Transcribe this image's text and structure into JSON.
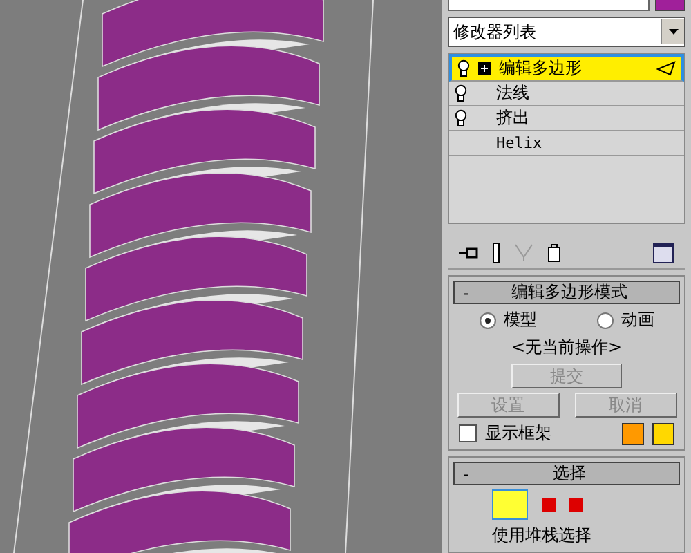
{
  "modifier_list": {
    "label": "修改器列表"
  },
  "stack": [
    {
      "label": "编辑多边形",
      "selected": true,
      "kind": "modifier",
      "expandable": true
    },
    {
      "label": "法线",
      "selected": false,
      "kind": "modifier",
      "expandable": false
    },
    {
      "label": "挤出",
      "selected": false,
      "kind": "modifier",
      "expandable": false
    },
    {
      "label": "Helix",
      "selected": false,
      "kind": "base",
      "expandable": false
    }
  ],
  "mode_rollout": {
    "title": "编辑多边形模式",
    "collapse": "-",
    "radios": [
      {
        "label": "模型",
        "selected": true
      },
      {
        "label": "动画",
        "selected": false
      }
    ],
    "status": "<无当前操作>",
    "commit": {
      "label": "提交",
      "disabled": true
    },
    "buttons": [
      {
        "label": "设置",
        "disabled": true
      },
      {
        "label": "取消",
        "disabled": true
      }
    ],
    "show_cage": {
      "label": "显示框架",
      "checked": false
    },
    "cage_colors": [
      {
        "color": "#ff9900"
      },
      {
        "color": "#ffd800"
      }
    ]
  },
  "select_rollout": {
    "title": "选择",
    "collapse": "-",
    "use_stack": "使用堆栈选择"
  }
}
